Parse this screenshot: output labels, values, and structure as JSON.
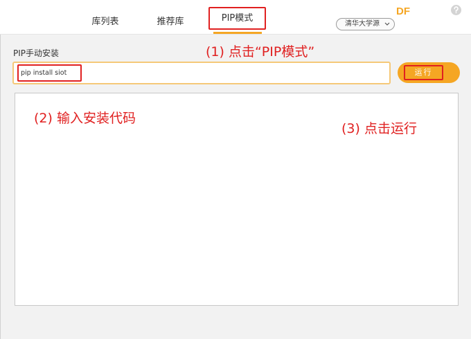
{
  "tabs": {
    "library_list": "库列表",
    "recommended": "推荐库",
    "pip_mode": "PIP模式"
  },
  "mirror": {
    "selected": "清华大学源"
  },
  "brand": "DF",
  "icons": {
    "help": "help-icon",
    "dropdown": "chevron-down-icon"
  },
  "pip_install": {
    "section_label": "PIP手动安装",
    "input_value": "pip install siot",
    "run_label": "运行"
  },
  "annotations": {
    "step1": "(1) 点击“PIP模式”",
    "step2": "(2) 输入安装代码",
    "step3": "(3) 点击运行"
  },
  "colors": {
    "accent": "#f5a623",
    "annotation": "#e02020"
  }
}
